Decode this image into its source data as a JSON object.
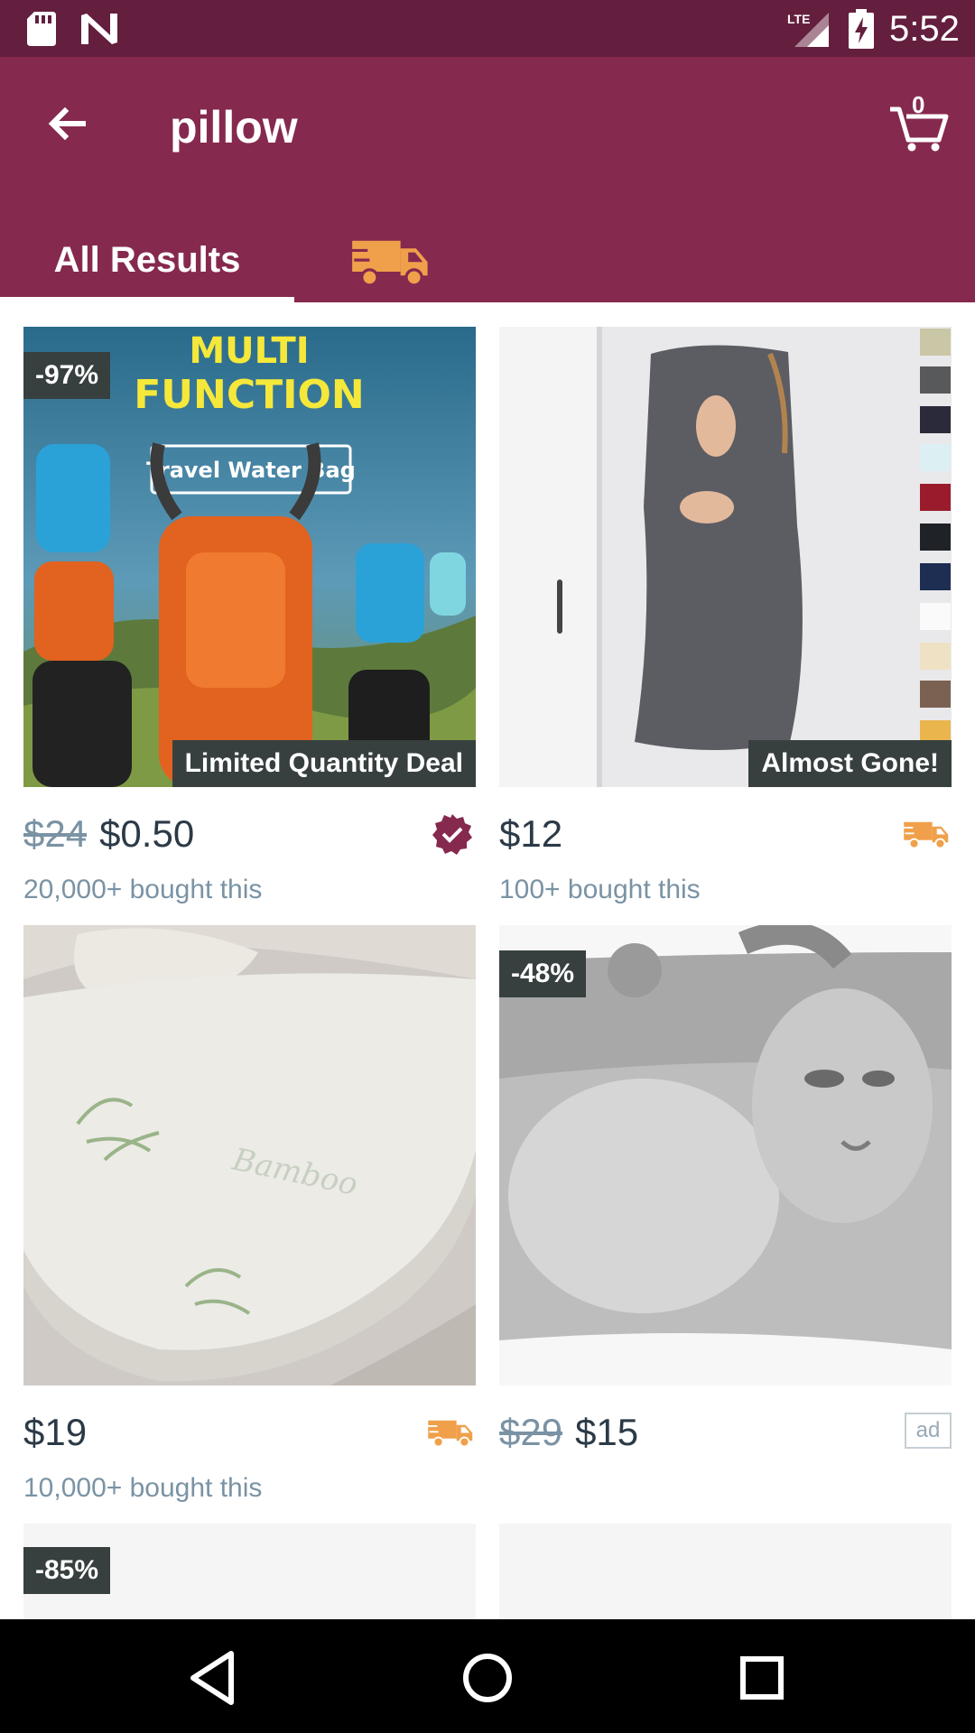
{
  "status_bar": {
    "time": "5:52",
    "network": "LTE",
    "icons": [
      "sd-card-icon",
      "n-notification-icon",
      "lte-signal-icon",
      "battery-charging-icon"
    ]
  },
  "app_bar": {
    "search_query": "pillow",
    "cart_count": "0",
    "tabs": [
      {
        "label": "All Results",
        "selected": true
      },
      {
        "icon": "express-truck-icon",
        "selected": false
      }
    ]
  },
  "colors": {
    "status_bar": "#641f3e",
    "app_bar": "#86294f",
    "accent_orange": "#f0a04b",
    "badge_bg": "#37403f",
    "price_text": "#2c3a47",
    "muted_text": "#7a93a4"
  },
  "products": [
    {
      "image_text": {
        "line1": "MULTI",
        "line2": "FUNCTION",
        "line3": "Travel Water Bag"
      },
      "discount_badge": "-97%",
      "deal_badge": "Limited Quantity Deal",
      "old_price": "$24",
      "price": "$0.50",
      "bought": "20,000+ bought this",
      "corner_icon": "verified-check-icon"
    },
    {
      "deal_badge": "Almost Gone!",
      "price": "$12",
      "bought": "100+ bought this",
      "corner_icon": "express-truck-icon"
    },
    {
      "image_text": {
        "word": "Bamboo"
      },
      "price": "$19",
      "bought": "10,000+ bought this",
      "corner_icon": "express-truck-icon"
    },
    {
      "discount_badge": "-48%",
      "old_price": "$29",
      "price": "$15",
      "ad_label": "ad"
    },
    {
      "discount_badge": "-85%"
    }
  ],
  "nav_bar": {
    "buttons": [
      "back-triangle-icon",
      "home-circle-icon",
      "recents-square-icon"
    ]
  }
}
